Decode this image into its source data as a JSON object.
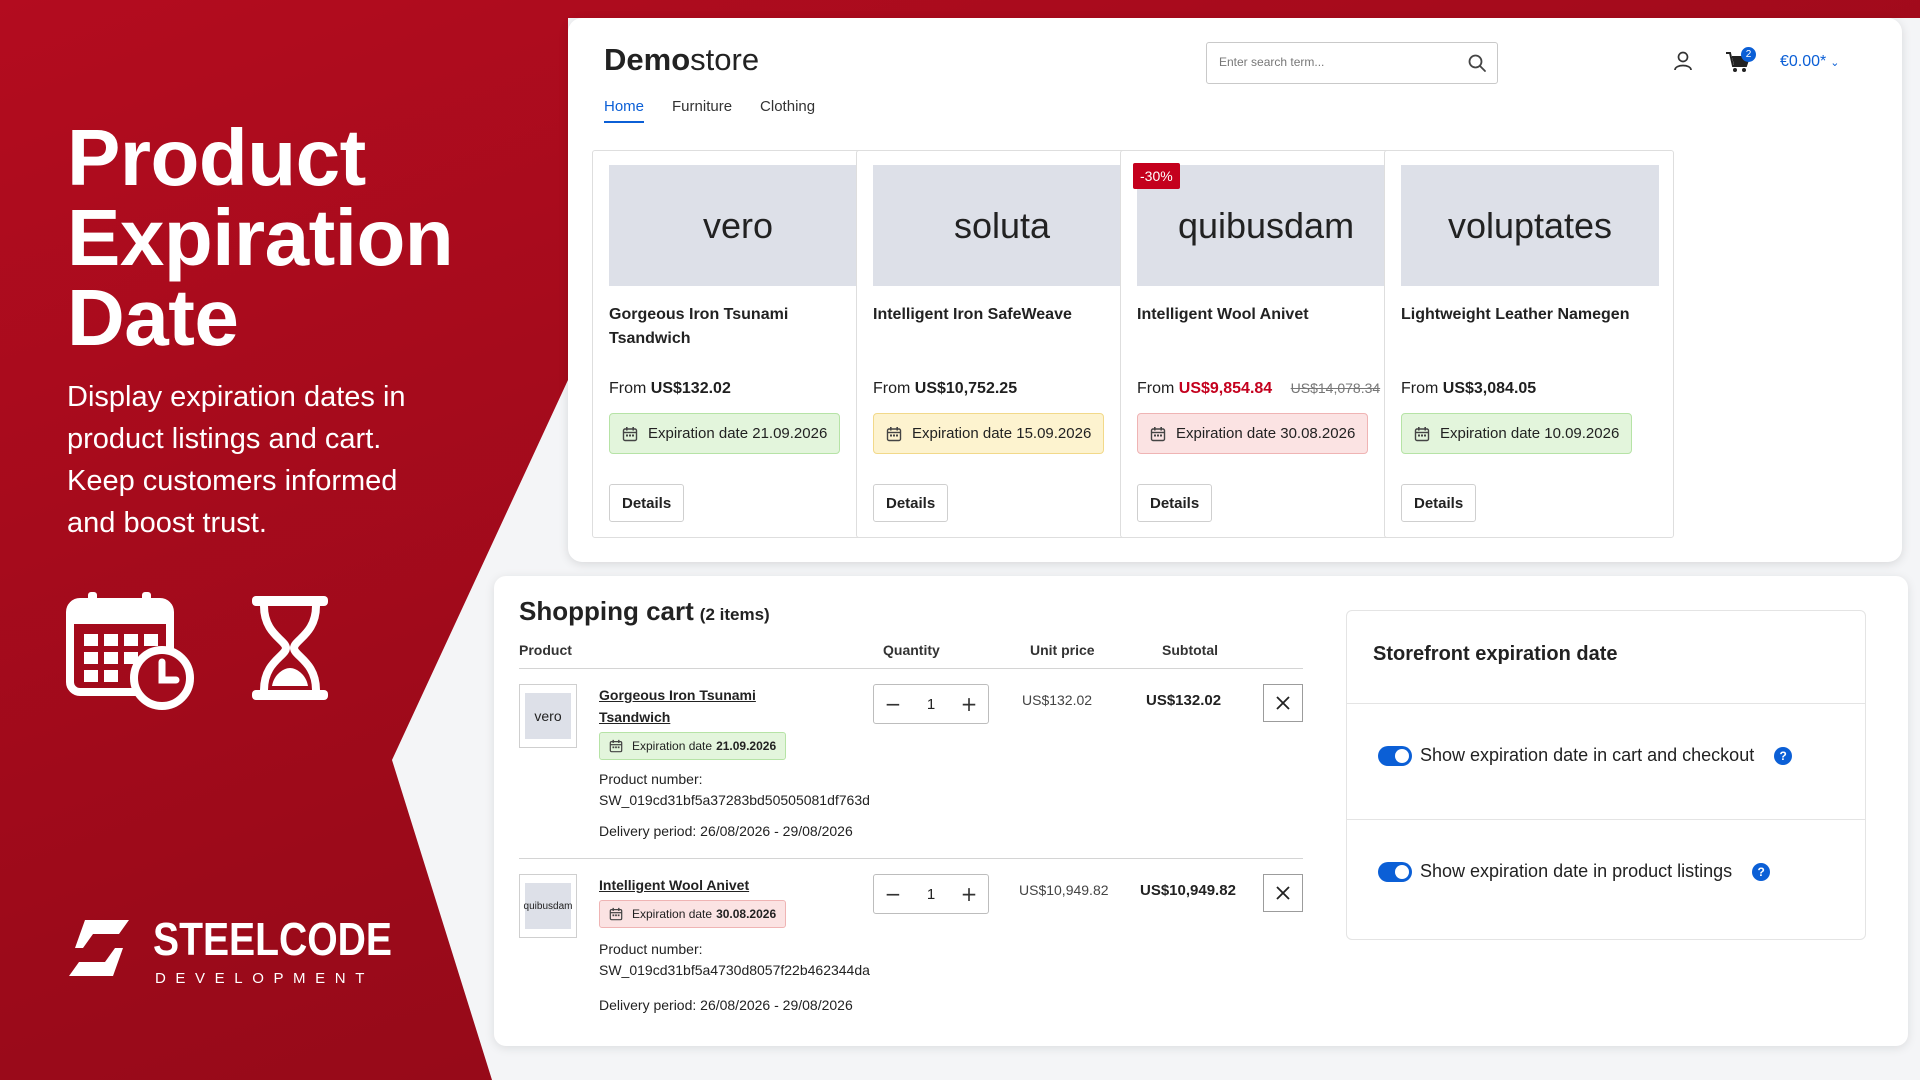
{
  "hero": {
    "title_lines": [
      "Product",
      "Expiration",
      "Date"
    ],
    "description_lines": [
      "Display expiration dates in",
      "product listings and cart.",
      "Keep customers informed",
      "and boost trust."
    ],
    "icons": [
      "calendar-clock-icon",
      "hourglass-icon"
    ]
  },
  "brand": {
    "name": "STEELCODE",
    "sub": "DEVELOPMENT"
  },
  "colors": {
    "brand_red": "#a30b1c",
    "accent_blue": "#0b5fd6",
    "sale_red": "#c4001d"
  },
  "store": {
    "logo_bold": "Demo",
    "logo_rest": "store",
    "nav": [
      "Home",
      "Furniture",
      "Clothing"
    ],
    "search_placeholder": "Enter search term...",
    "cart_badge": "2",
    "cart_total": "€0.00*",
    "products": [
      {
        "image_label": "vero",
        "name": "Gorgeous Iron Tsunami Tsandwich",
        "price_prefix": "From",
        "price": "US$132.02",
        "old_price": "",
        "discount": "",
        "expiration": "Expiration date 21.09.2026",
        "exp_status": "green",
        "details": "Details"
      },
      {
        "image_label": "soluta",
        "name": "Intelligent Iron SafeWeave",
        "price_prefix": "From",
        "price": "US$10,752.25",
        "old_price": "",
        "discount": "",
        "expiration": "Expiration date 15.09.2026",
        "exp_status": "yellow",
        "details": "Details"
      },
      {
        "image_label": "quibusdam",
        "name": "Intelligent Wool Anivet",
        "price_prefix": "From",
        "price": "US$9,854.84",
        "old_price": "US$14,078.34",
        "discount": "-30%",
        "expiration": "Expiration date 30.08.2026",
        "exp_status": "red",
        "details": "Details"
      },
      {
        "image_label": "voluptates",
        "name": "Lightweight Leather Namegen",
        "price_prefix": "From",
        "price": "US$3,084.05",
        "old_price": "",
        "discount": "",
        "expiration": "Expiration date 10.09.2026",
        "exp_status": "green",
        "details": "Details"
      }
    ]
  },
  "cart": {
    "title": "Shopping cart",
    "count": "(2 items)",
    "headers": {
      "product": "Product",
      "quantity": "Quantity",
      "unit_price": "Unit price",
      "subtotal": "Subtotal"
    },
    "items": [
      {
        "thumb": "vero",
        "name_lines": [
          "Gorgeous Iron Tsunami",
          "Tsandwich"
        ],
        "exp_label": "Expiration date",
        "exp_date": "21.09.2026",
        "exp_status": "green",
        "product_number_label": "Product number:",
        "product_number": "SW_019cd31bf5a37283bd50505081df763d",
        "delivery": "Delivery period: 26/08/2026 - 29/08/2026",
        "quantity": "1",
        "unit_price": "US$132.02",
        "subtotal": "US$132.02"
      },
      {
        "thumb": "quibusdam",
        "name_lines": [
          "Intelligent Wool Anivet"
        ],
        "exp_label": "Expiration date",
        "exp_date": "30.08.2026",
        "exp_status": "red",
        "product_number_label": "Product number:",
        "product_number": "SW_019cd31bf5a4730d8057f22b462344da",
        "delivery": "Delivery period: 26/08/2026 - 29/08/2026",
        "quantity": "1",
        "unit_price": "US$10,949.82",
        "subtotal": "US$10,949.82"
      }
    ]
  },
  "settings": {
    "title": "Storefront expiration date",
    "options": [
      {
        "label": "Show expiration date in cart and checkout",
        "enabled": true
      },
      {
        "label": "Show expiration date in product listings",
        "enabled": true
      }
    ],
    "help_glyph": "?"
  }
}
